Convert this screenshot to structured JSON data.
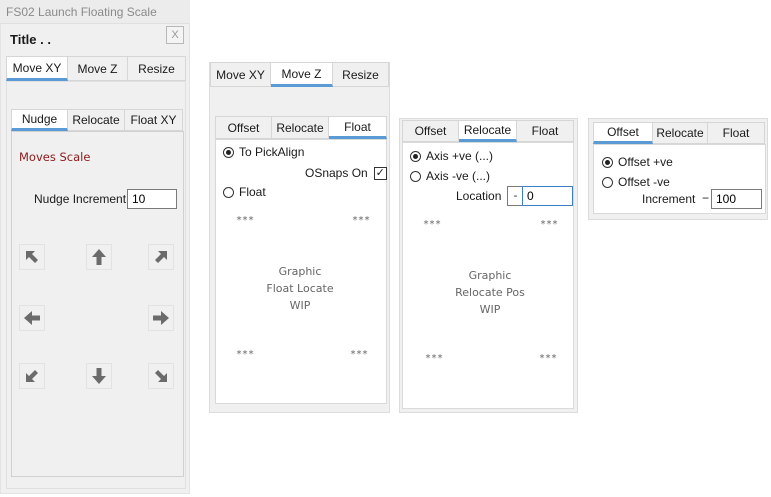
{
  "window": {
    "title": "FS02 Launch Floating Scale",
    "close_label": "X",
    "heading": "Title . ."
  },
  "main_tabs": [
    "Move XY",
    "Move Z",
    "Resize"
  ],
  "movexy": {
    "sub_tabs": [
      "Nudge",
      "Relocate",
      "Float XY"
    ],
    "moves_label": "Moves Scale",
    "nudge_label": "Nudge Increment",
    "nudge_value": "10",
    "arrows": [
      "up-left",
      "up",
      "up-right",
      "left",
      "right",
      "down-left",
      "down",
      "down-right"
    ]
  },
  "movez": {
    "main_tabs": [
      "Move XY",
      "Move Z",
      "Resize"
    ],
    "sub_tabs": [
      "Offset",
      "Relocate",
      "Float"
    ],
    "to_pickalign": "To PickAlign",
    "osnaps": "OSnaps On",
    "osnaps_mark": "✓",
    "float": "Float",
    "stars": "***",
    "graphic_lines": [
      "Graphic",
      "Float Locate",
      "WIP"
    ]
  },
  "relocate": {
    "sub_tabs": [
      "Offset",
      "Relocate",
      "Float"
    ],
    "axis_pos": "Axis +ve (...)",
    "axis_neg": "Axis -ve (...)",
    "location_label": "Location",
    "location_sign": "-",
    "location_value": "0",
    "stars": "***",
    "graphic_lines": [
      "Graphic",
      "Relocate Pos",
      "WIP"
    ]
  },
  "offset": {
    "sub_tabs": [
      "Offset",
      "Relocate",
      "Float"
    ],
    "offset_pos": "Offset +ve",
    "offset_neg": "Offset -ve",
    "increment_label": "Increment",
    "increment_sign": "−",
    "increment_value": "100"
  },
  "colors": {
    "accent": "#5b9bd5",
    "moves_text": "#8b1a1a",
    "panel_bg": "#f0f0f0"
  }
}
